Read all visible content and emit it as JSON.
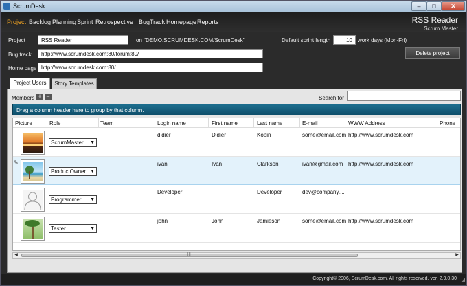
{
  "window": {
    "title": "ScrumDesk",
    "min": "–",
    "max": "□",
    "close": "✕"
  },
  "menu": {
    "items": [
      "Project",
      "Backlog",
      "Planning",
      "Sprint",
      "Retrospective",
      "BugTrack",
      "Homepage",
      "Reports"
    ],
    "active": "Project",
    "project_name": "RSS Reader",
    "role": "Scrum Master"
  },
  "form": {
    "project_label": "Project",
    "project_value": "RSS Reader",
    "project_server": "on \"DEMO.SCRUMDESK.COM/ScrumDesk\"",
    "sprint_length_label": "Default sprint length",
    "sprint_length_value": "10",
    "sprint_length_unit": "work days (Mon-Fri)",
    "bugtrack_label": "Bug track",
    "bugtrack_value": "http://www.scrumdesk.com:80/forum:80/",
    "homepage_label": "Home page",
    "homepage_value": "http://www.scrumdesk.com:80/",
    "delete_button": "Delete project"
  },
  "tabs": [
    {
      "label": "Project Users",
      "active": true
    },
    {
      "label": "Story Templates",
      "active": false
    }
  ],
  "members": {
    "label": "Members",
    "add": "+",
    "remove": "−",
    "search_label": "Search for",
    "search_value": ""
  },
  "grid": {
    "group_hint": "Drag a column header here to group by that column.",
    "columns": [
      "Picture",
      "Role",
      "Team",
      "Login name",
      "First name",
      "Last name",
      "E-mail",
      "WWW Address",
      "Phone"
    ],
    "rows": [
      {
        "picture": "sunset-photo",
        "role": "ScrumMaster",
        "team": "",
        "login": "didier",
        "first": "Didier",
        "last": "Kopin",
        "email": "some@email.com",
        "www": "http://www.scrumdesk.com",
        "selected": false
      },
      {
        "picture": "beach-photo",
        "role": "ProductOwner",
        "team": "",
        "login": "ivan",
        "first": "Ivan",
        "last": "Clarkson",
        "email": "ivan@gmail.com",
        "www": "http://www.scrumdesk.com",
        "selected": true
      },
      {
        "picture": "silhouette",
        "role": "Programmer",
        "team": "",
        "login": "Developer",
        "first": "",
        "last": "Developer",
        "email": "dev@company....",
        "www": "",
        "selected": false
      },
      {
        "picture": "palm-photo",
        "role": "Tester",
        "team": "",
        "login": "john",
        "first": "John",
        "last": "Jamieson",
        "email": "some@email.com",
        "www": "http://www.scrumdesk.com",
        "selected": false
      }
    ]
  },
  "scroll": {
    "left": "◀",
    "right": "▶",
    "grip": "|||"
  },
  "footer": {
    "copyright": "Copyright© 2006, ScrumDesk.com. All rights reserved. ver. 2.9.0.30"
  },
  "colors": {
    "accent": "#f5a623",
    "group_bar": "#1d6e8e",
    "selected_row": "#e3f2fb"
  }
}
